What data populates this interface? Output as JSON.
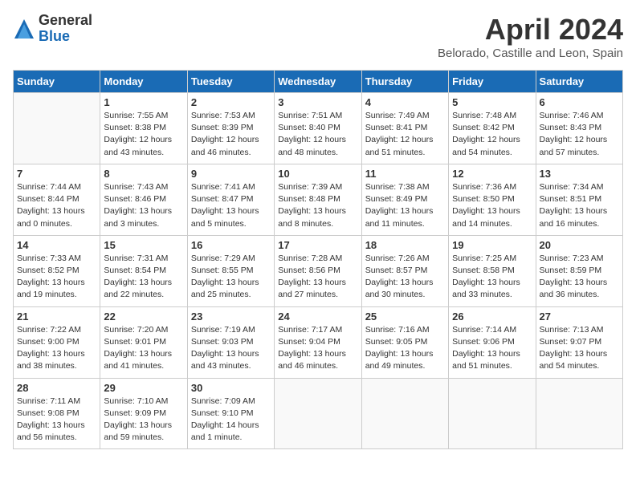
{
  "logo": {
    "general": "General",
    "blue": "Blue"
  },
  "title": "April 2024",
  "subtitle": "Belorado, Castille and Leon, Spain",
  "days_of_week": [
    "Sunday",
    "Monday",
    "Tuesday",
    "Wednesday",
    "Thursday",
    "Friday",
    "Saturday"
  ],
  "weeks": [
    [
      {
        "day": "",
        "sunrise": "",
        "sunset": "",
        "daylight": ""
      },
      {
        "day": "1",
        "sunrise": "Sunrise: 7:55 AM",
        "sunset": "Sunset: 8:38 PM",
        "daylight": "Daylight: 12 hours and 43 minutes."
      },
      {
        "day": "2",
        "sunrise": "Sunrise: 7:53 AM",
        "sunset": "Sunset: 8:39 PM",
        "daylight": "Daylight: 12 hours and 46 minutes."
      },
      {
        "day": "3",
        "sunrise": "Sunrise: 7:51 AM",
        "sunset": "Sunset: 8:40 PM",
        "daylight": "Daylight: 12 hours and 48 minutes."
      },
      {
        "day": "4",
        "sunrise": "Sunrise: 7:49 AM",
        "sunset": "Sunset: 8:41 PM",
        "daylight": "Daylight: 12 hours and 51 minutes."
      },
      {
        "day": "5",
        "sunrise": "Sunrise: 7:48 AM",
        "sunset": "Sunset: 8:42 PM",
        "daylight": "Daylight: 12 hours and 54 minutes."
      },
      {
        "day": "6",
        "sunrise": "Sunrise: 7:46 AM",
        "sunset": "Sunset: 8:43 PM",
        "daylight": "Daylight: 12 hours and 57 minutes."
      }
    ],
    [
      {
        "day": "7",
        "sunrise": "Sunrise: 7:44 AM",
        "sunset": "Sunset: 8:44 PM",
        "daylight": "Daylight: 13 hours and 0 minutes."
      },
      {
        "day": "8",
        "sunrise": "Sunrise: 7:43 AM",
        "sunset": "Sunset: 8:46 PM",
        "daylight": "Daylight: 13 hours and 3 minutes."
      },
      {
        "day": "9",
        "sunrise": "Sunrise: 7:41 AM",
        "sunset": "Sunset: 8:47 PM",
        "daylight": "Daylight: 13 hours and 5 minutes."
      },
      {
        "day": "10",
        "sunrise": "Sunrise: 7:39 AM",
        "sunset": "Sunset: 8:48 PM",
        "daylight": "Daylight: 13 hours and 8 minutes."
      },
      {
        "day": "11",
        "sunrise": "Sunrise: 7:38 AM",
        "sunset": "Sunset: 8:49 PM",
        "daylight": "Daylight: 13 hours and 11 minutes."
      },
      {
        "day": "12",
        "sunrise": "Sunrise: 7:36 AM",
        "sunset": "Sunset: 8:50 PM",
        "daylight": "Daylight: 13 hours and 14 minutes."
      },
      {
        "day": "13",
        "sunrise": "Sunrise: 7:34 AM",
        "sunset": "Sunset: 8:51 PM",
        "daylight": "Daylight: 13 hours and 16 minutes."
      }
    ],
    [
      {
        "day": "14",
        "sunrise": "Sunrise: 7:33 AM",
        "sunset": "Sunset: 8:52 PM",
        "daylight": "Daylight: 13 hours and 19 minutes."
      },
      {
        "day": "15",
        "sunrise": "Sunrise: 7:31 AM",
        "sunset": "Sunset: 8:54 PM",
        "daylight": "Daylight: 13 hours and 22 minutes."
      },
      {
        "day": "16",
        "sunrise": "Sunrise: 7:29 AM",
        "sunset": "Sunset: 8:55 PM",
        "daylight": "Daylight: 13 hours and 25 minutes."
      },
      {
        "day": "17",
        "sunrise": "Sunrise: 7:28 AM",
        "sunset": "Sunset: 8:56 PM",
        "daylight": "Daylight: 13 hours and 27 minutes."
      },
      {
        "day": "18",
        "sunrise": "Sunrise: 7:26 AM",
        "sunset": "Sunset: 8:57 PM",
        "daylight": "Daylight: 13 hours and 30 minutes."
      },
      {
        "day": "19",
        "sunrise": "Sunrise: 7:25 AM",
        "sunset": "Sunset: 8:58 PM",
        "daylight": "Daylight: 13 hours and 33 minutes."
      },
      {
        "day": "20",
        "sunrise": "Sunrise: 7:23 AM",
        "sunset": "Sunset: 8:59 PM",
        "daylight": "Daylight: 13 hours and 36 minutes."
      }
    ],
    [
      {
        "day": "21",
        "sunrise": "Sunrise: 7:22 AM",
        "sunset": "Sunset: 9:00 PM",
        "daylight": "Daylight: 13 hours and 38 minutes."
      },
      {
        "day": "22",
        "sunrise": "Sunrise: 7:20 AM",
        "sunset": "Sunset: 9:01 PM",
        "daylight": "Daylight: 13 hours and 41 minutes."
      },
      {
        "day": "23",
        "sunrise": "Sunrise: 7:19 AM",
        "sunset": "Sunset: 9:03 PM",
        "daylight": "Daylight: 13 hours and 43 minutes."
      },
      {
        "day": "24",
        "sunrise": "Sunrise: 7:17 AM",
        "sunset": "Sunset: 9:04 PM",
        "daylight": "Daylight: 13 hours and 46 minutes."
      },
      {
        "day": "25",
        "sunrise": "Sunrise: 7:16 AM",
        "sunset": "Sunset: 9:05 PM",
        "daylight": "Daylight: 13 hours and 49 minutes."
      },
      {
        "day": "26",
        "sunrise": "Sunrise: 7:14 AM",
        "sunset": "Sunset: 9:06 PM",
        "daylight": "Daylight: 13 hours and 51 minutes."
      },
      {
        "day": "27",
        "sunrise": "Sunrise: 7:13 AM",
        "sunset": "Sunset: 9:07 PM",
        "daylight": "Daylight: 13 hours and 54 minutes."
      }
    ],
    [
      {
        "day": "28",
        "sunrise": "Sunrise: 7:11 AM",
        "sunset": "Sunset: 9:08 PM",
        "daylight": "Daylight: 13 hours and 56 minutes."
      },
      {
        "day": "29",
        "sunrise": "Sunrise: 7:10 AM",
        "sunset": "Sunset: 9:09 PM",
        "daylight": "Daylight: 13 hours and 59 minutes."
      },
      {
        "day": "30",
        "sunrise": "Sunrise: 7:09 AM",
        "sunset": "Sunset: 9:10 PM",
        "daylight": "Daylight: 14 hours and 1 minute."
      },
      {
        "day": "",
        "sunrise": "",
        "sunset": "",
        "daylight": ""
      },
      {
        "day": "",
        "sunrise": "",
        "sunset": "",
        "daylight": ""
      },
      {
        "day": "",
        "sunrise": "",
        "sunset": "",
        "daylight": ""
      },
      {
        "day": "",
        "sunrise": "",
        "sunset": "",
        "daylight": ""
      }
    ]
  ]
}
